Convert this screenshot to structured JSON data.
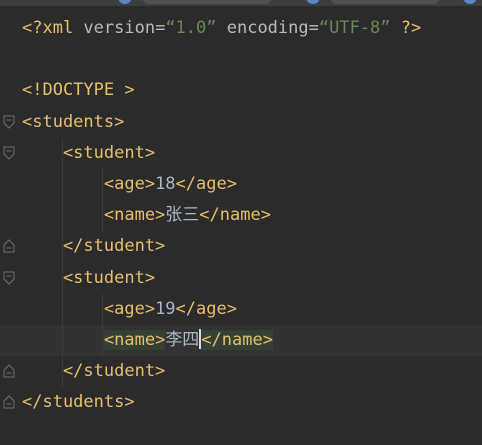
{
  "editor": {
    "lines": [
      {
        "tokens": [
          {
            "text": "<?xml ",
            "cls": "t-tag"
          },
          {
            "text": "version=",
            "cls": "t-attr"
          },
          {
            "text": "“1.0”",
            "cls": "t-str"
          },
          {
            "text": " encoding=",
            "cls": "t-attr"
          },
          {
            "text": "“UTF-8”",
            "cls": "t-str"
          },
          {
            "text": " ?>",
            "cls": "t-tag"
          }
        ]
      },
      {
        "tokens": []
      },
      {
        "tokens": [
          {
            "text": "<!DOCTYPE >",
            "cls": "t-tag"
          }
        ]
      },
      {
        "tokens": [
          {
            "text": "<students>",
            "cls": "t-tag"
          }
        ]
      },
      {
        "tokens": [
          {
            "text": "    <student>",
            "cls": "t-tag"
          }
        ]
      },
      {
        "tokens": [
          {
            "text": "        <age>",
            "cls": "t-tag"
          },
          {
            "text": "18",
            "cls": "t-text"
          },
          {
            "text": "</age>",
            "cls": "t-tag"
          }
        ]
      },
      {
        "tokens": [
          {
            "text": "        <name>",
            "cls": "t-tag"
          },
          {
            "text": "张三",
            "cls": "t-text"
          },
          {
            "text": "</name>",
            "cls": "t-tag"
          }
        ]
      },
      {
        "tokens": [
          {
            "text": "    </student>",
            "cls": "t-tag"
          }
        ]
      },
      {
        "tokens": [
          {
            "text": "    <student>",
            "cls": "t-tag"
          }
        ]
      },
      {
        "tokens": [
          {
            "text": "        <age>",
            "cls": "t-tag"
          },
          {
            "text": "19",
            "cls": "t-text"
          },
          {
            "text": "</age>",
            "cls": "t-tag"
          }
        ]
      },
      {
        "tokens": [
          {
            "text": "        ",
            "cls": "t-tag"
          },
          {
            "text": "<name>",
            "cls": "t-tag hl"
          },
          {
            "text": "李四",
            "cls": "t-text"
          },
          {
            "text": "|caret|",
            "cls": "caret"
          },
          {
            "text": "</name>",
            "cls": "t-tag hl"
          }
        ]
      },
      {
        "tokens": [
          {
            "text": "    </student>",
            "cls": "t-tag"
          }
        ]
      },
      {
        "tokens": [
          {
            "text": "</students>",
            "cls": "t-tag"
          }
        ]
      }
    ],
    "current_line": 11,
    "fold_markers": [
      {
        "line": 4,
        "kind": "open"
      },
      {
        "line": 5,
        "kind": "open"
      },
      {
        "line": 8,
        "kind": "close"
      },
      {
        "line": 9,
        "kind": "open"
      },
      {
        "line": 12,
        "kind": "close"
      },
      {
        "line": 13,
        "kind": "close"
      }
    ]
  }
}
